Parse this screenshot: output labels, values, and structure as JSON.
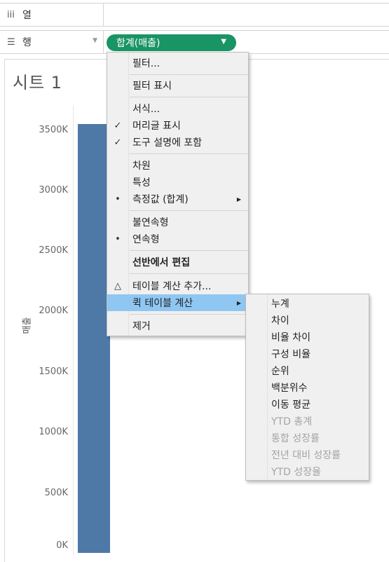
{
  "shelves": {
    "columns": {
      "icon": "iii",
      "label": "열"
    },
    "rows": {
      "icon": "☰",
      "label": "행",
      "pill": "합계(매출)"
    }
  },
  "sheet": {
    "title": "시트 1",
    "axis_title": "매출",
    "y_ticks": [
      "3500K",
      "3000K",
      "2500K",
      "2000K",
      "1500K",
      "1000K",
      "500K",
      "0K"
    ]
  },
  "chart_data": {
    "type": "bar",
    "categories": [
      ""
    ],
    "values": [
      3560000
    ],
    "ylabel": "매출",
    "ylim": [
      0,
      3620000
    ],
    "grid": false
  },
  "context_menu": {
    "filter": "필터...",
    "show_filter": "필터 표시",
    "format": "서식...",
    "show_header": "머리글 표시",
    "include_tooltip": "도구 설명에 포함",
    "dimension": "차원",
    "attribute": "특성",
    "measure": "측정값 (합계)",
    "discrete": "불연속형",
    "continuous": "연속형",
    "edit_in_shelf": "선반에서 편집",
    "add_table_calc": "테이블 계산 추가...",
    "quick_table_calc": "퀵 테이블 계산",
    "remove": "제거",
    "check_mark": "✓",
    "bullet_mark": "•",
    "delta_mark": "△"
  },
  "submenu": {
    "running_total": "누계",
    "difference": "차이",
    "percent_difference": "비율 차이",
    "percent_of_total": "구성 비율",
    "rank": "순위",
    "percentile": "백분위수",
    "moving_average": "이동 평균",
    "ytd_total": "YTD 총계",
    "compound_growth": "통합 성장률",
    "yoy_growth": "전년 대비 성장률",
    "ytd_growth": "YTD 성장율"
  },
  "colors": {
    "pill": "#199464",
    "bar": "#4e79a7",
    "highlight": "#8fc7f2"
  }
}
